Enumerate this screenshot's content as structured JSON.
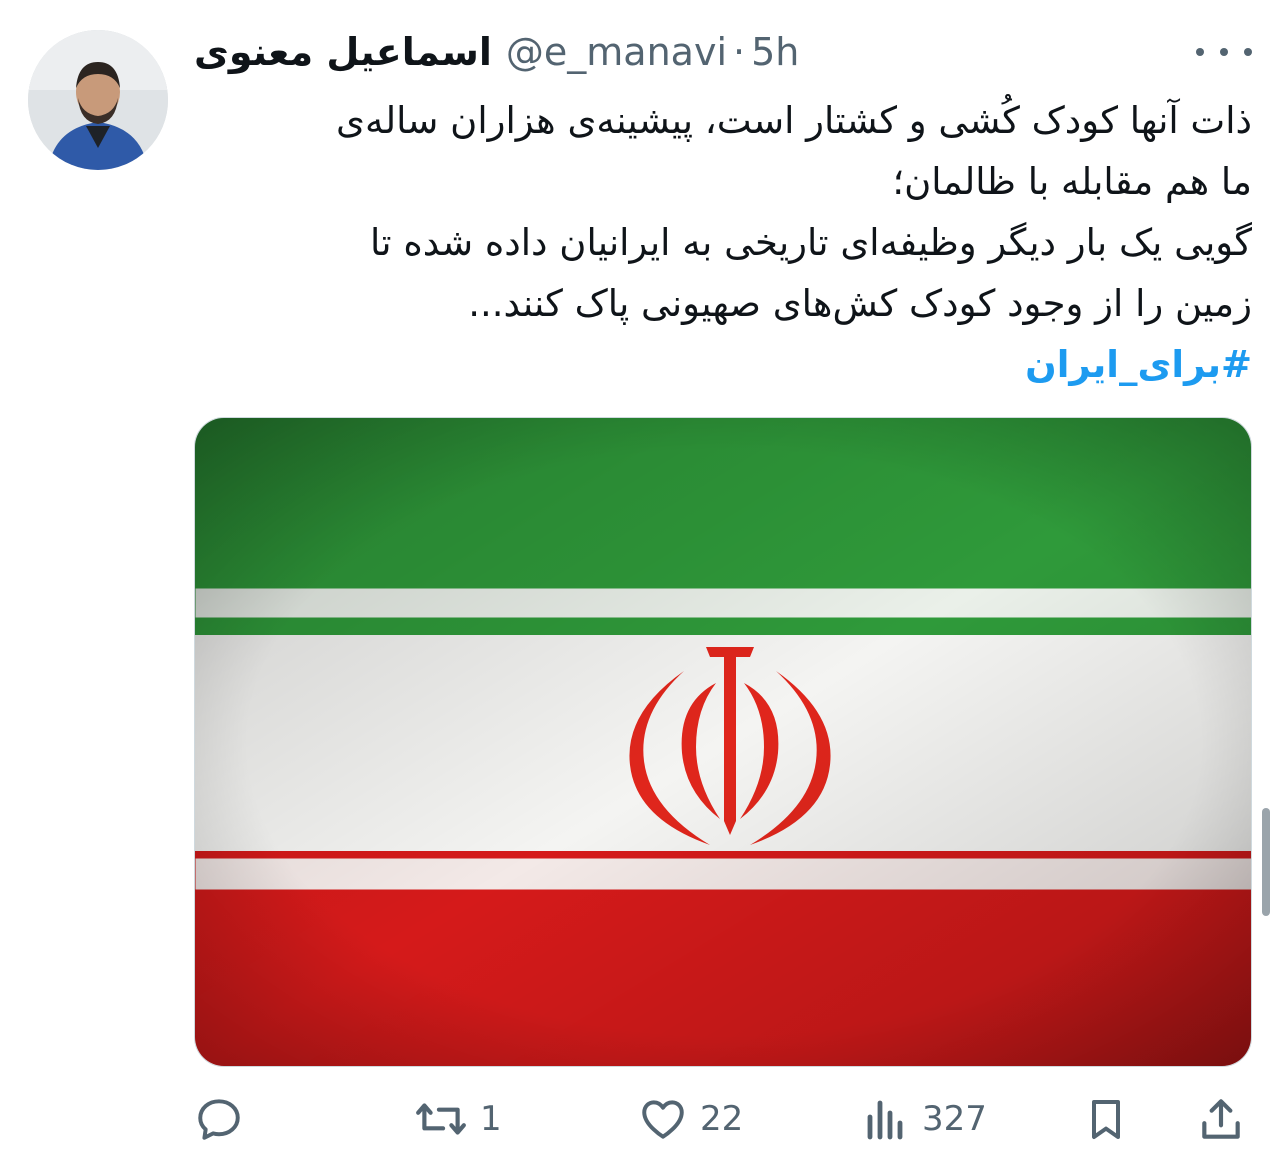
{
  "author": {
    "name": "اسماعیل معنوی",
    "handle": "@e_manavi",
    "separator": "·",
    "time": "5h"
  },
  "tweet": {
    "lines": [
      "ذات آنها کودک کُشی و کشتار است، پیشینه‌ی هزاران ساله‌ی",
      "ما هم مقابله با ظالمان؛",
      "گویی یک بار دیگر وظیفه‌ای تاریخی به ایرانیان داده شده تا",
      "زمین را از وجود کودک کش‌های صهیونی پاک کنند..."
    ],
    "hashtag": "#برای_ایران"
  },
  "media": {
    "alt": "Flag of Iran"
  },
  "actions": {
    "reply_count": "",
    "retweet_count": "1",
    "like_count": "22",
    "views_count": "327"
  },
  "colors": {
    "hashtag": "#1d9bf0",
    "secondary_text": "#536471",
    "flag_green": "#239f40",
    "flag_white": "#ffffff",
    "flag_red": "#da0000"
  }
}
